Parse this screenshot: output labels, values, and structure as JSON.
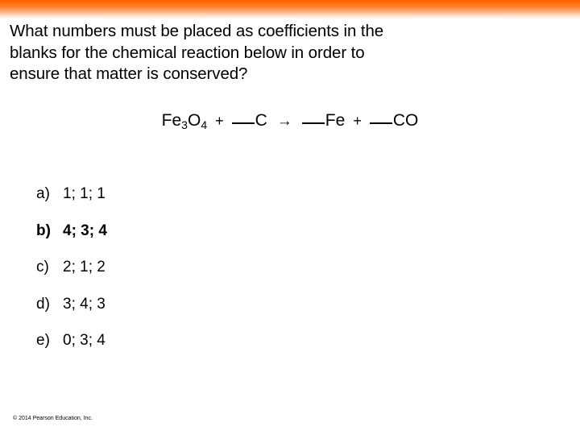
{
  "decor": {
    "top_band_color_start": "#ff5f00",
    "top_band_color_end": "#ffffff"
  },
  "question": {
    "lines": [
      "What numbers must be placed as coefficients in the",
      "blanks for the chemical reaction below in order to",
      "ensure that matter is conserved?"
    ]
  },
  "equation": {
    "reactant1": "Fe",
    "reactant1_sub1": "3",
    "reactant1_element2": "O",
    "reactant1_sub2": "4",
    "plus1": "+",
    "blank1_species": "C",
    "arrow": "→",
    "blank2_species": "Fe",
    "plus2": "+",
    "blank3_species": "CO",
    "plain_text": "Fe3O4 + __C → __Fe + __CO"
  },
  "choices": [
    {
      "label": "a)",
      "value": "1; 1; 1",
      "correct": false
    },
    {
      "label": "b)",
      "value": "4; 3; 4",
      "correct": true
    },
    {
      "label": "c)",
      "value": "2; 1; 2",
      "correct": false
    },
    {
      "label": "d)",
      "value": "3; 4; 3",
      "correct": false
    },
    {
      "label": "e)",
      "value": "0; 3; 4",
      "correct": false
    }
  ],
  "footer": {
    "copyright": "© 2014 Pearson Education, Inc."
  }
}
